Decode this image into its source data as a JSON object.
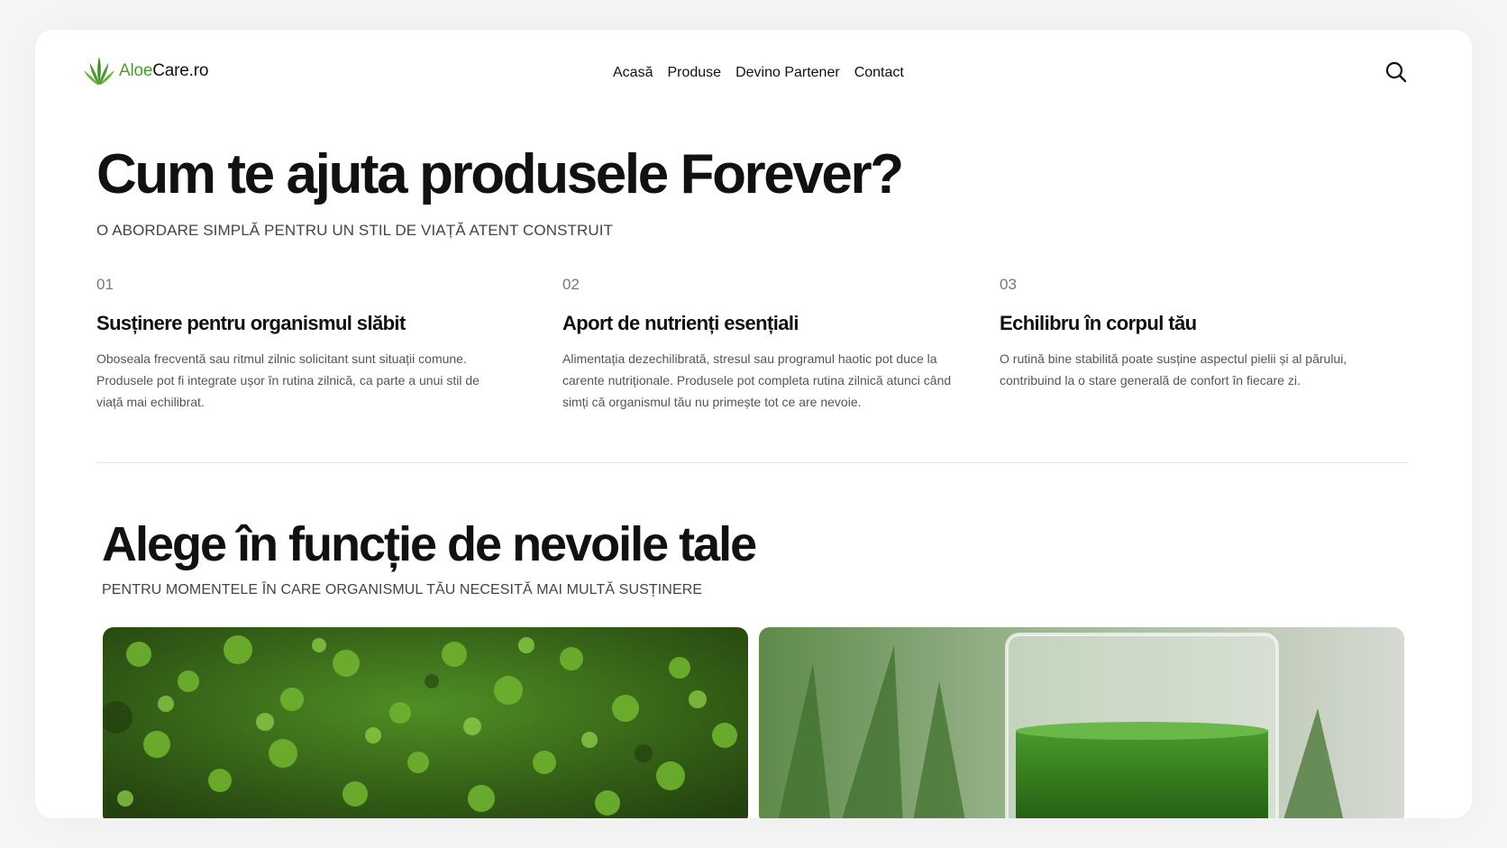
{
  "header": {
    "logo": {
      "accent": "Aloe",
      "rest": "Care.ro"
    },
    "nav": [
      "Acasă",
      "Produse",
      "Devino Partener",
      "Contact"
    ],
    "search_icon": "search-icon"
  },
  "section1": {
    "title": "Cum te ajuta produsele Forever?",
    "subtitle": "O ABORDARE SIMPLĂ PENTRU UN STIL DE VIAȚĂ ATENT CONSTRUIT",
    "features": [
      {
        "num": "01",
        "title": "Susținere pentru organismul slăbit",
        "desc": "Oboseala frecventă sau ritmul zilnic solicitant sunt situații comune. Produsele pot fi integrate ușor în rutina zilnică, ca parte a unui stil de viață mai echilibrat."
      },
      {
        "num": "02",
        "title": "Aport de nutrienți esențiali",
        "desc": "Alimentația dezechilibrată, stresul sau programul haotic pot duce la carente nutriționale. Produsele pot completa rutina zilnică atunci când simți că organismul tău nu primește tot ce are nevoie."
      },
      {
        "num": "03",
        "title": "Echilibru în corpul tău",
        "desc": "O rutină bine stabilită poate susține aspectul pielii și al părului, contribuind la o stare generală de confort în fiecare zi."
      }
    ]
  },
  "section2": {
    "title": "Alege în funcție de nevoile tale",
    "subtitle": "PENTRU MOMENTELE ÎN CARE ORGANISMUL TĂU NECESITĂ MAI MULTĂ SUSȚINERE"
  },
  "colors": {
    "brand_green": "#4f9a2d",
    "text": "#111111",
    "muted": "#555555"
  }
}
